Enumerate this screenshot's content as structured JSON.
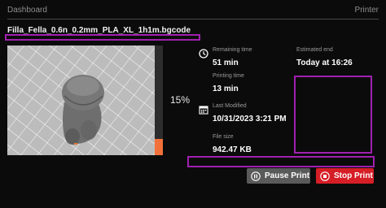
{
  "nav": {
    "dashboard_label": "Dashboard",
    "printer_label": "Printer"
  },
  "job": {
    "filename": "Filla_Fella_0.6n_0.2mm_PLA_XL_1h1m.bgcode",
    "progress_percent": 15,
    "progress_text": "15%"
  },
  "info": {
    "remaining_label": "Remaining time",
    "remaining_value": "51 min",
    "estimated_end_label": "Estimated end",
    "estimated_end_value": "Today at 16:26",
    "printing_time_label": "Printing time",
    "printing_time_value": "13 min",
    "last_modified_label": "Last Modified",
    "last_modified_value": "10/31/2023 3:21 PM",
    "file_size_label": "File size",
    "file_size_value": "942.47 KB"
  },
  "actions": {
    "pause_label": "Pause Print",
    "stop_label": "Stop Print"
  },
  "colors": {
    "background": "#0b0b0b",
    "progress_fill": "#f2703a",
    "stop_button": "#d61e26",
    "pause_button": "#5a5a5a",
    "highlight": "#a020b0"
  },
  "icons": {
    "remaining": "clock-icon",
    "last_modified": "calendar-icon",
    "pause": "pause-icon",
    "stop": "stop-icon"
  }
}
